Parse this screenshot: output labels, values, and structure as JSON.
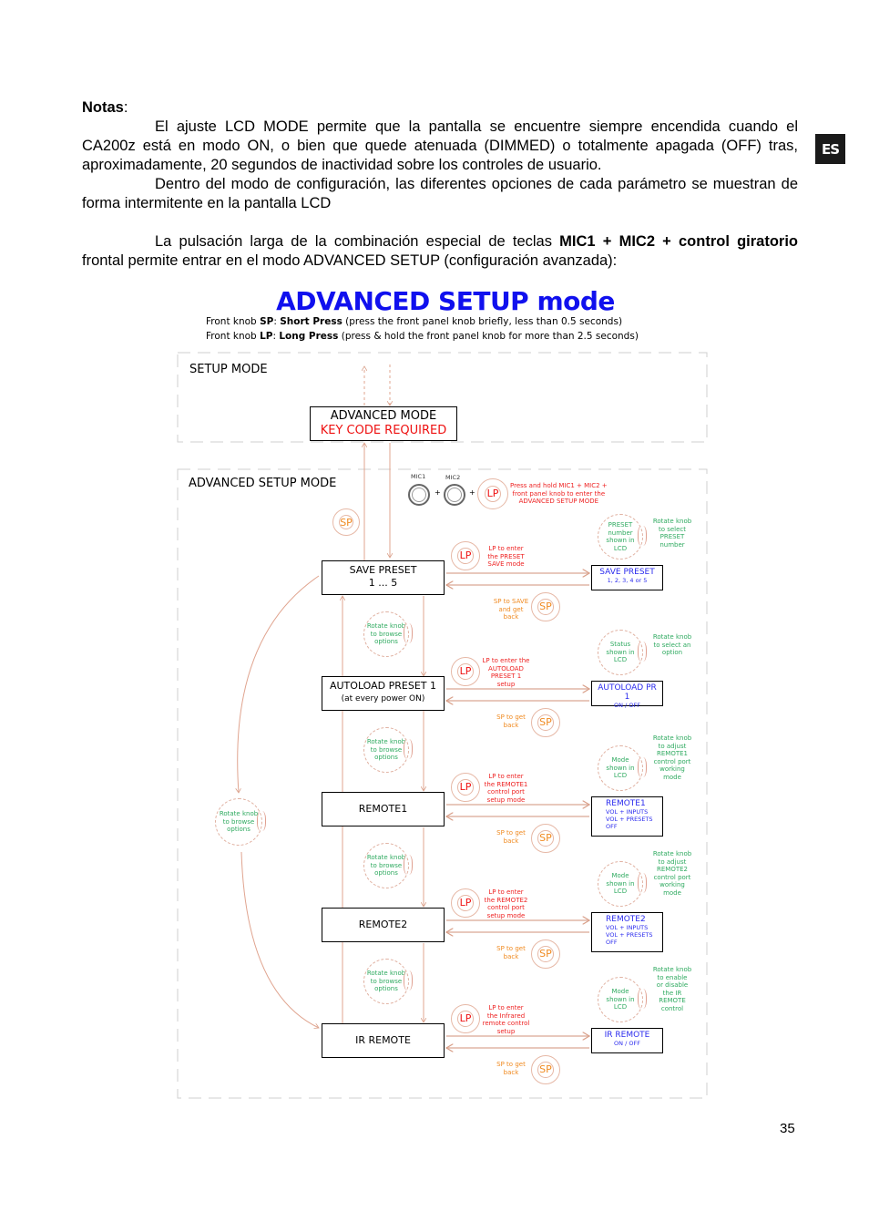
{
  "notes": {
    "heading": "Notas",
    "heading_suffix": ":",
    "p1": "El ajuste LCD MODE permite que la pantalla se encuentre siempre encendida cuando el CA200z está en modo ON, o bien que quede atenuada (DIMMED) o totalmente apagada (OFF)  tras, aproximadamente, 20 segundos de inactividad sobre los controles de usuario.",
    "p2": "Dentro del modo de configuración, las diferentes opciones de cada parámetro se muestran de forma intermitente en la pantalla LCD",
    "p3_a": "La pulsación larga de la combinación especial de teclas ",
    "p3_bold": "MIC1 + MIC2 + control giratorio",
    "p3_b": " frontal permite entrar en el modo ADVANCED SETUP (configuración avanzada):"
  },
  "language_tab": "ES",
  "page_number": "35",
  "diagram": {
    "title": "ADVANCED SETUP mode",
    "legend": [
      {
        "prefix": "Front knob ",
        "key": "SP",
        "sep": ": ",
        "name": "Short Press",
        "desc": " (press the front panel knob briefly, less than 0.5 seconds)"
      },
      {
        "prefix": "Front knob ",
        "key": "LP",
        "sep": ": ",
        "name": "Long Press",
        "desc": " (press & hold the front panel knob for more than 2.5 seconds)"
      }
    ],
    "setup_mode_label": "SETUP MODE",
    "advanced_mode_box": {
      "line1": "ADVANCED MODE",
      "line2": "KEY CODE REQUIRED"
    },
    "advanced_setup_label": "ADVANCED SETUP MODE",
    "mic1": "MIC1",
    "mic2": "MIC2",
    "plus": "+",
    "enter_note": [
      "Press and hold MIC1 + MIC2 +",
      "front panel knob to enter the",
      "ADVANCED SETUP MODE"
    ],
    "sp": "SP",
    "lp": "LP",
    "browse_note": [
      "Rotate knob",
      "to browse",
      "options"
    ],
    "steps": [
      {
        "box": [
          "SAVE PRESET",
          "1 ... 5"
        ],
        "lp_note": [
          "LP to enter",
          "the PRESET",
          "SAVE mode"
        ],
        "sp_note": [
          "SP to SAVE",
          "and get",
          "back"
        ],
        "lcd_circle": [
          "PRESET",
          "number",
          "shown in",
          "LCD"
        ],
        "rotate_note": [
          "Rotate knob",
          "to select",
          "PRESET",
          "number"
        ],
        "lcd": {
          "title": "SAVE PRESET",
          "options": [
            "1, 2, 3, 4 or 5"
          ]
        }
      },
      {
        "box": [
          "AUTOLOAD PRESET 1",
          "(at every power ON)"
        ],
        "lp_note": [
          "LP to enter the",
          "AUTOLOAD",
          "PRESET 1",
          "setup"
        ],
        "sp_note": [
          "SP to get",
          "back"
        ],
        "lcd_circle": [
          "Status",
          "shown in",
          "LCD"
        ],
        "rotate_note": [
          "Rotate knob",
          "to select an",
          "option"
        ],
        "lcd": {
          "title": "AUTOLOAD PR 1",
          "options": [
            "ON  /  OFF"
          ]
        }
      },
      {
        "box": [
          "REMOTE1"
        ],
        "lp_note": [
          "LP to enter",
          "the REMOTE1",
          "control port",
          "setup mode"
        ],
        "sp_note": [
          "SP to get",
          "back"
        ],
        "lcd_circle": [
          "Mode",
          "shown in",
          "LCD"
        ],
        "rotate_note": [
          "Rotate knob",
          "to adjust",
          "REMOTE1",
          "control port",
          "working",
          "mode"
        ],
        "lcd": {
          "title": "REMOTE1",
          "options": [
            "VOL + INPUTS",
            "VOL + PRESETS",
            "OFF"
          ]
        }
      },
      {
        "box": [
          "REMOTE2"
        ],
        "lp_note": [
          "LP to enter",
          "the REMOTE2",
          "control port",
          "setup mode"
        ],
        "sp_note": [
          "SP to get",
          "back"
        ],
        "lcd_circle": [
          "Mode",
          "shown in",
          "LCD"
        ],
        "rotate_note": [
          "Rotate knob",
          "to adjust",
          "REMOTE2",
          "control port",
          "working",
          "mode"
        ],
        "lcd": {
          "title": "REMOTE2",
          "options": [
            "VOL + INPUTS",
            "VOL + PRESETS",
            "OFF"
          ]
        }
      },
      {
        "box": [
          "IR REMOTE"
        ],
        "lp_note": [
          "LP to enter",
          "the Infrared",
          "remote control",
          "setup"
        ],
        "sp_note": [
          "SP to get",
          "back"
        ],
        "lcd_circle": [
          "Mode",
          "shown in",
          "LCD"
        ],
        "rotate_note": [
          "Rotate knob",
          "to enable",
          "or disable",
          "the IR",
          "REMOTE",
          "control"
        ],
        "lcd": {
          "title": "IR REMOTE",
          "options": [
            "ON  /  OFF"
          ]
        }
      }
    ]
  }
}
